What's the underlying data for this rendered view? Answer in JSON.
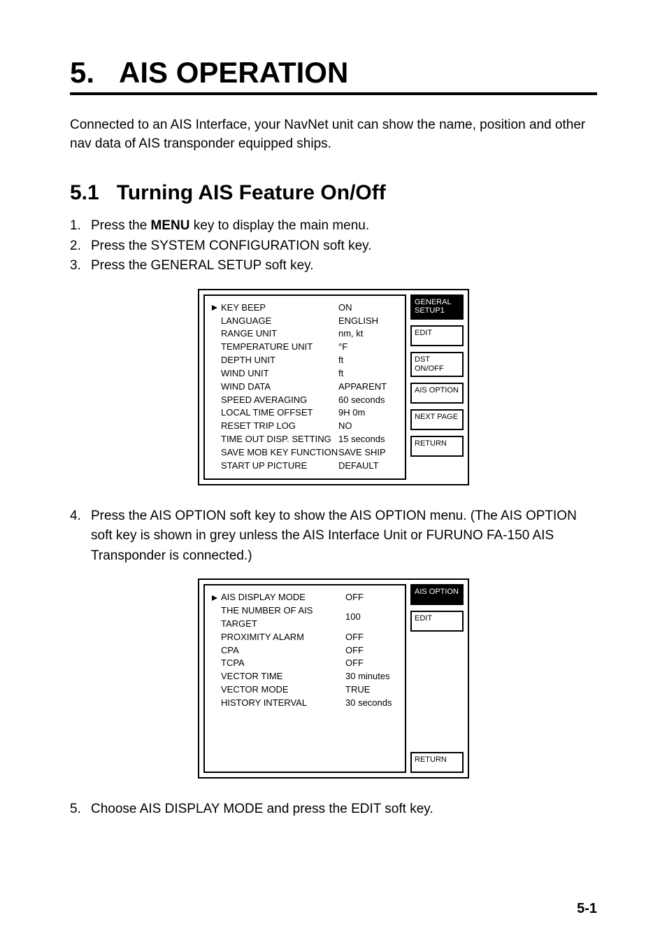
{
  "chapter": {
    "number": "5.",
    "title": "AIS OPERATION"
  },
  "intro": "Connected to an AIS Interface, your NavNet unit can show the name, position and other nav data of AIS transponder equipped ships.",
  "section": {
    "number": "5.1",
    "title": "Turning AIS Feature On/Off"
  },
  "steps_a": [
    {
      "num": "1.",
      "pre": "Press the ",
      "bold": "MENU",
      "post": " key to display the main menu."
    },
    {
      "num": "2.",
      "pre": "Press the SYSTEM CONFIGURATION soft key.",
      "bold": "",
      "post": ""
    },
    {
      "num": "3.",
      "pre": "Press the GENERAL SETUP soft key.",
      "bold": "",
      "post": ""
    }
  ],
  "general_setup": {
    "title_softkey": "GENERAL SETUP1",
    "softkeys": [
      "EDIT",
      "DST ON/OFF",
      "AIS OPTION",
      "NEXT PAGE",
      "RETURN"
    ],
    "rows": [
      {
        "label": "KEY BEEP",
        "value": "ON",
        "selected": true
      },
      {
        "label": "LANGUAGE",
        "value": "ENGLISH",
        "selected": false
      },
      {
        "label": "RANGE UNIT",
        "value": "nm, kt",
        "selected": false
      },
      {
        "label": "TEMPERATURE UNIT",
        "value": "°F",
        "selected": false
      },
      {
        "label": "DEPTH UNIT",
        "value": "ft",
        "selected": false
      },
      {
        "label": "WIND UNIT",
        "value": "ft",
        "selected": false
      },
      {
        "label": "WIND DATA",
        "value": "APPARENT",
        "selected": false
      },
      {
        "label": "SPEED AVERAGING",
        "value": "60 seconds",
        "selected": false
      },
      {
        "label": "LOCAL TIME OFFSET",
        "value": "9H 0m",
        "selected": false
      },
      {
        "label": "RESET TRIP LOG",
        "value": "NO",
        "selected": false
      },
      {
        "label": "TIME OUT DISP. SETTING",
        "value": "15 seconds",
        "selected": false
      },
      {
        "label": "SAVE MOB KEY FUNCTION",
        "value": "SAVE SHIP",
        "selected": false
      },
      {
        "label": "START UP PICTURE",
        "value": "DEFAULT",
        "selected": false
      }
    ]
  },
  "steps_b": [
    {
      "num": "4.",
      "text": "Press the AIS OPTION soft key to show the AIS OPTION menu. (The AIS OPTION soft key is shown in grey unless the AIS Interface Unit or FURUNO FA-150 AIS Transponder is connected.)"
    }
  ],
  "ais_option": {
    "title_softkey": "AIS OPTION",
    "softkeys": [
      "EDIT",
      "RETURN"
    ],
    "rows": [
      {
        "label": "AIS DISPLAY MODE",
        "value": "OFF",
        "selected": true
      },
      {
        "label": "THE NUMBER OF AIS TARGET",
        "value": "100",
        "selected": false
      },
      {
        "label": "PROXIMITY ALARM",
        "value": "OFF",
        "selected": false
      },
      {
        "label": "CPA",
        "value": "OFF",
        "selected": false
      },
      {
        "label": "TCPA",
        "value": "OFF",
        "selected": false
      },
      {
        "label": "VECTOR TIME",
        "value": "30 minutes",
        "selected": false
      },
      {
        "label": "VECTOR MODE",
        "value": "TRUE",
        "selected": false
      },
      {
        "label": "HISTORY INTERVAL",
        "value": "30 seconds",
        "selected": false
      }
    ]
  },
  "steps_c": [
    {
      "num": "5.",
      "text": "Choose AIS DISPLAY MODE and press the EDIT soft key."
    }
  ],
  "page_number": "5-1"
}
